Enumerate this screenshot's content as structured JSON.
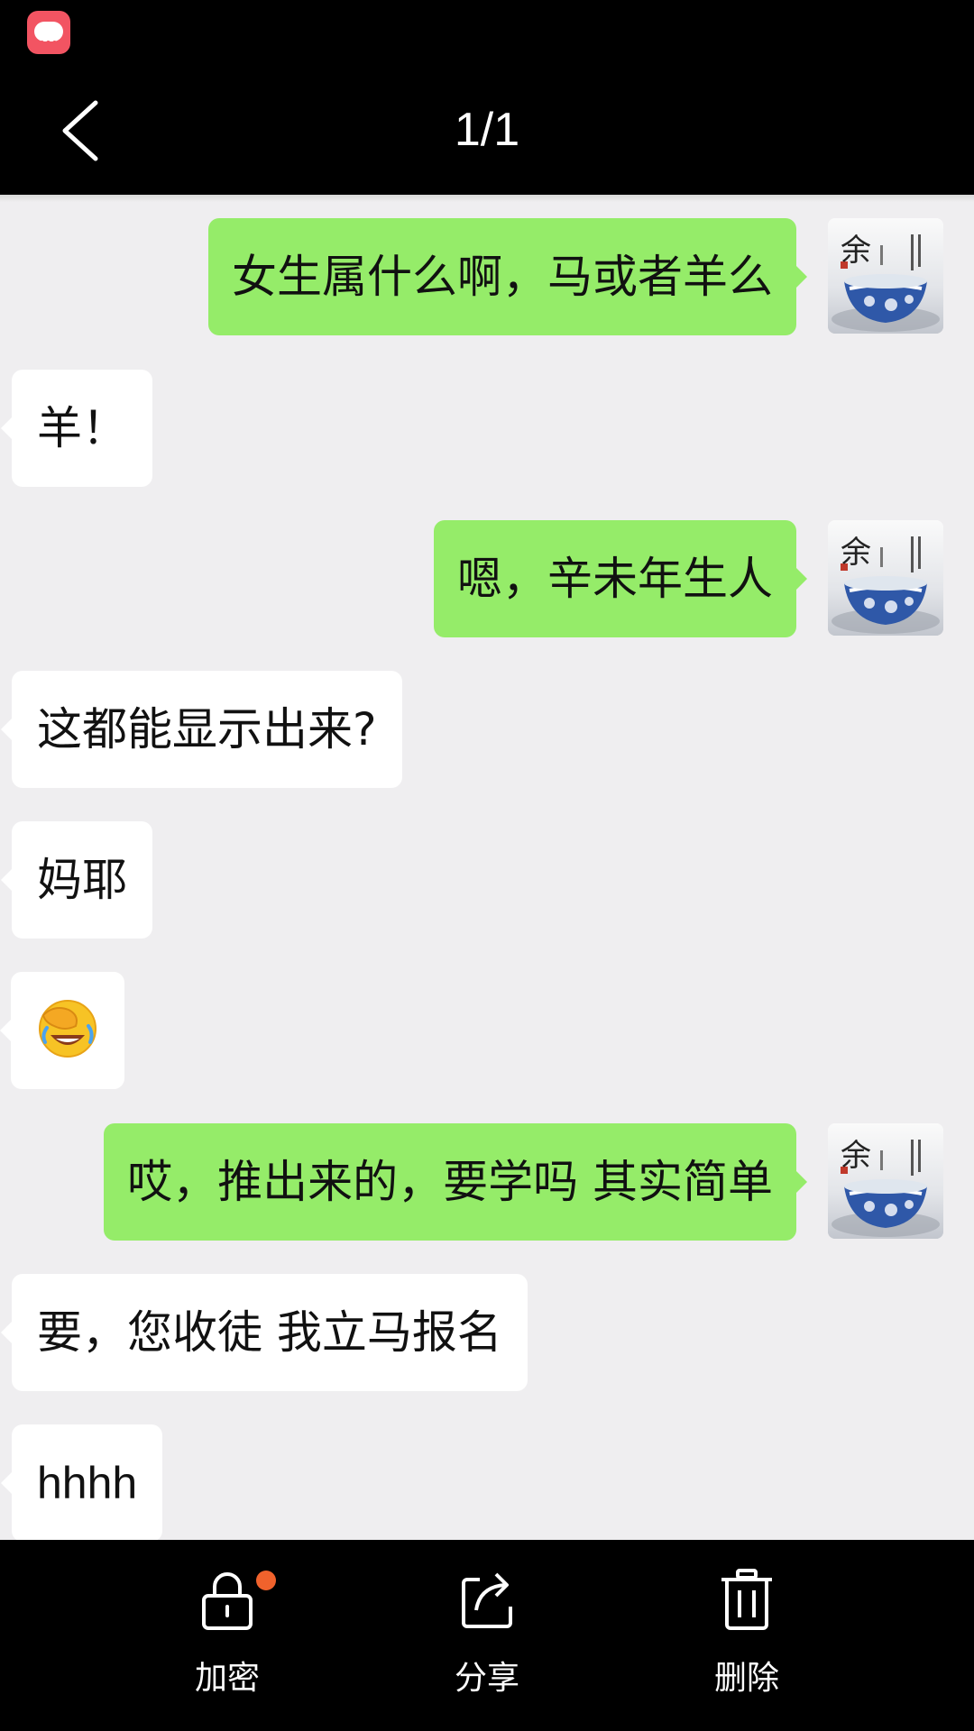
{
  "header": {
    "title": "1/1"
  },
  "messages": [
    {
      "side": "out",
      "text": "女生属什么啊，马或者羊么"
    },
    {
      "side": "in",
      "text": "羊！"
    },
    {
      "side": "out",
      "text": "嗯，辛未年生人"
    },
    {
      "side": "in",
      "text": "这都能显示出来?"
    },
    {
      "side": "in",
      "text": "妈耶"
    },
    {
      "side": "in",
      "emoji": "face-palm-laughing-emoji"
    },
    {
      "side": "out",
      "text": "哎，推出来的，要学吗 其实简单"
    },
    {
      "side": "in",
      "text": "要，您收徒  我立马报名"
    },
    {
      "side": "in",
      "text": "hhhh"
    }
  ],
  "avatar": {
    "glyph": "余",
    "description_icon": "blue-white-porcelain-bowl-avatar"
  },
  "actions": {
    "encrypt": {
      "label": "加密",
      "icon": "lock-icon"
    },
    "share": {
      "label": "分享",
      "icon": "share-icon"
    },
    "delete": {
      "label": "删除",
      "icon": "trash-icon"
    }
  },
  "colors": {
    "outgoing_bubble": "#95ec69",
    "incoming_bubble": "#ffffff",
    "chat_background": "#efeef0",
    "bars": "#000000",
    "notify_dot": "#f0622c",
    "status_app_icon": "#f25462"
  }
}
